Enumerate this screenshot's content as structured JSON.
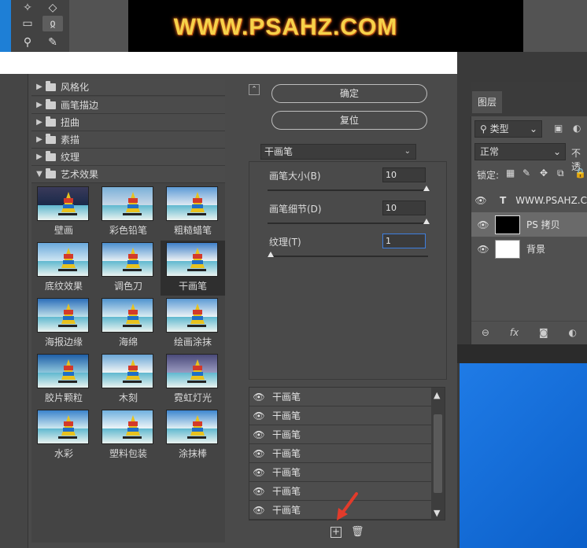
{
  "watermark": "WWW.PSAHZ.COM",
  "tree": {
    "categories": [
      {
        "label": "风格化",
        "expanded": false
      },
      {
        "label": "画笔描边",
        "expanded": false
      },
      {
        "label": "扭曲",
        "expanded": false
      },
      {
        "label": "素描",
        "expanded": false
      },
      {
        "label": "纹理",
        "expanded": false
      },
      {
        "label": "艺术效果",
        "expanded": true
      }
    ],
    "thumbs": [
      "壁画",
      "彩色铅笔",
      "粗糙蜡笔",
      "底纹效果",
      "调色刀",
      "干画笔",
      "海报边缘",
      "海绵",
      "绘画涂抹",
      "胶片颗粒",
      "木刻",
      "霓虹灯光",
      "水彩",
      "塑料包装",
      "涂抹棒"
    ],
    "selected": "干画笔"
  },
  "controls": {
    "ok_label": "确定",
    "reset_label": "复位",
    "filter_select": "干画笔",
    "params": [
      {
        "label": "画笔大小(B)",
        "value": "10",
        "fraction": 1.0
      },
      {
        "label": "画笔细节(D)",
        "value": "10",
        "fraction": 1.0
      },
      {
        "label": "纹理(T)",
        "value": "1",
        "fraction": 0.0
      }
    ]
  },
  "effect_layers": [
    "干画笔",
    "干画笔",
    "干画笔",
    "干画笔",
    "干画笔",
    "干画笔",
    "干画笔"
  ],
  "layers_panel": {
    "tab": "图层",
    "kind_filter": "类型",
    "blend_mode": "正常",
    "opacity_label": "不透",
    "lock_label": "锁定:",
    "layers": [
      {
        "name": "WWW.PSAHZ.C",
        "type": "text"
      },
      {
        "name": "PS 拷贝",
        "type": "image",
        "selected": true
      },
      {
        "name": "背景",
        "type": "fill"
      }
    ]
  }
}
